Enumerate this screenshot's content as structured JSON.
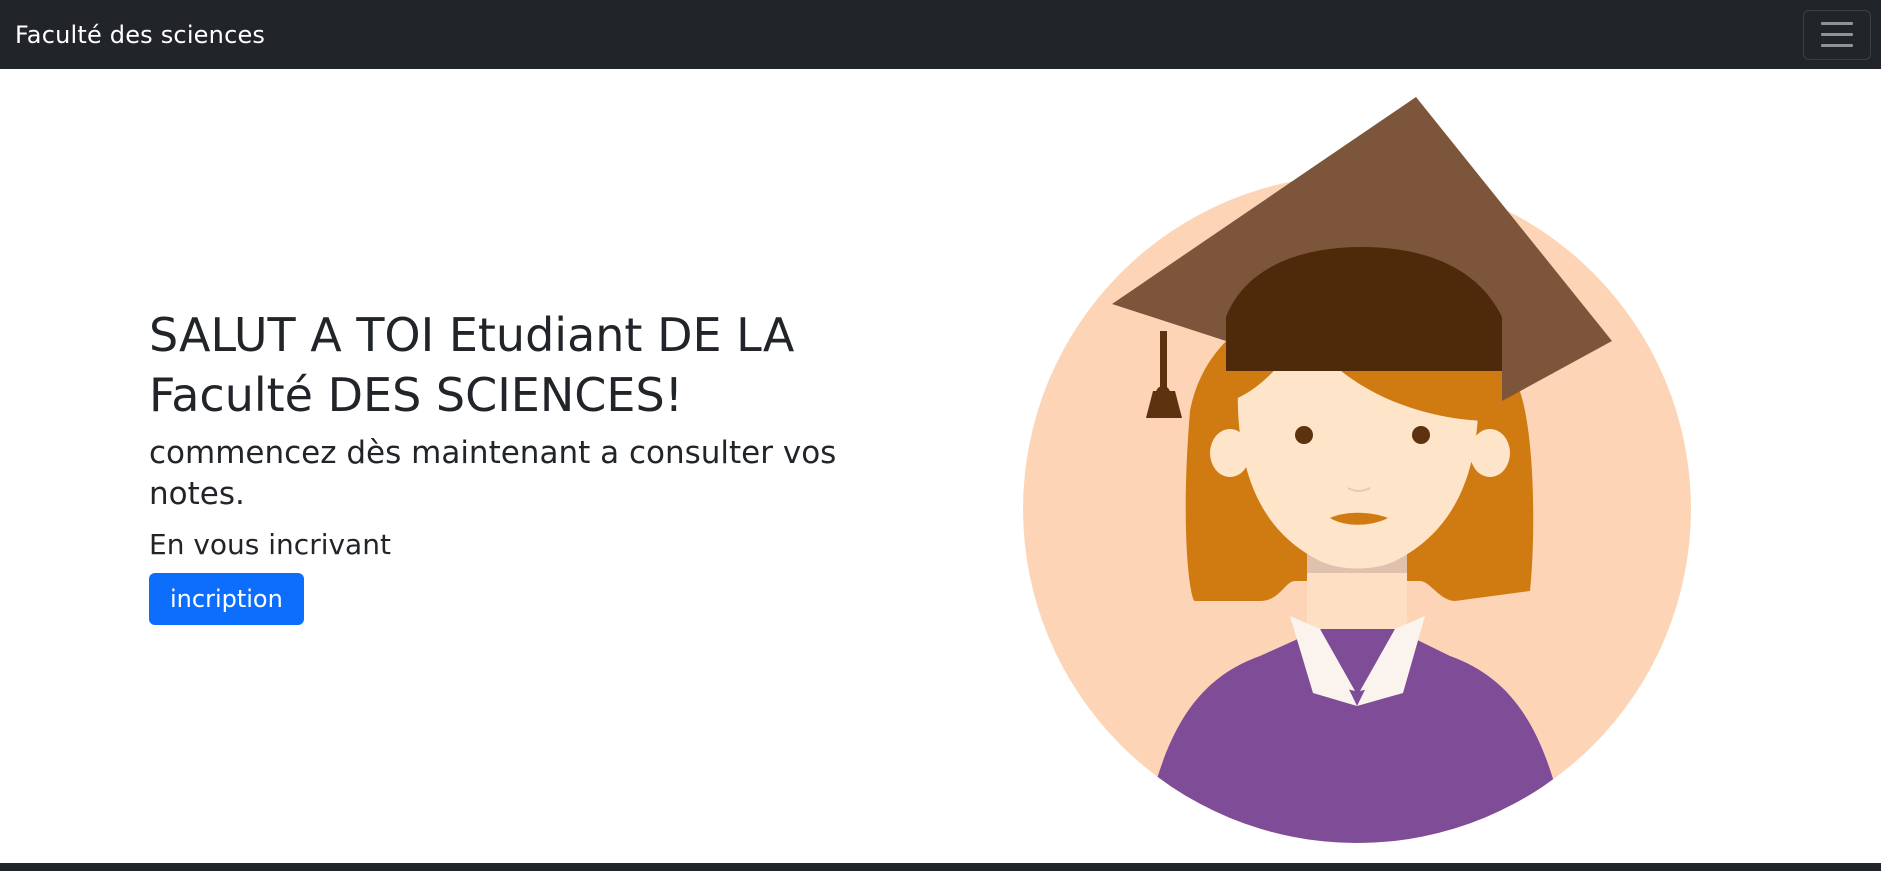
{
  "navbar": {
    "brand": "Faculté des sciences",
    "toggler_icon": "hamburger-menu-icon"
  },
  "hero": {
    "title": "SALUT A TOI Etudiant DE LA Faculté DES SCIENCES!",
    "subtitle": "commencez dès maintenant a consulter vos notes.",
    "small_text": "En vous incrivant",
    "button_label": "incription",
    "illustration": "graduate-student-illustration"
  },
  "colors": {
    "navbar_bg": "#212529",
    "primary": "#0d6efd",
    "circle_bg": "#fdd5b6",
    "cap": "#7d553b",
    "cap_inner": "#4e2a0a",
    "hair": "#d07a12",
    "skin": "#fee4c9",
    "sweater": "#7f4c97",
    "collar": "#fbf4ee"
  }
}
